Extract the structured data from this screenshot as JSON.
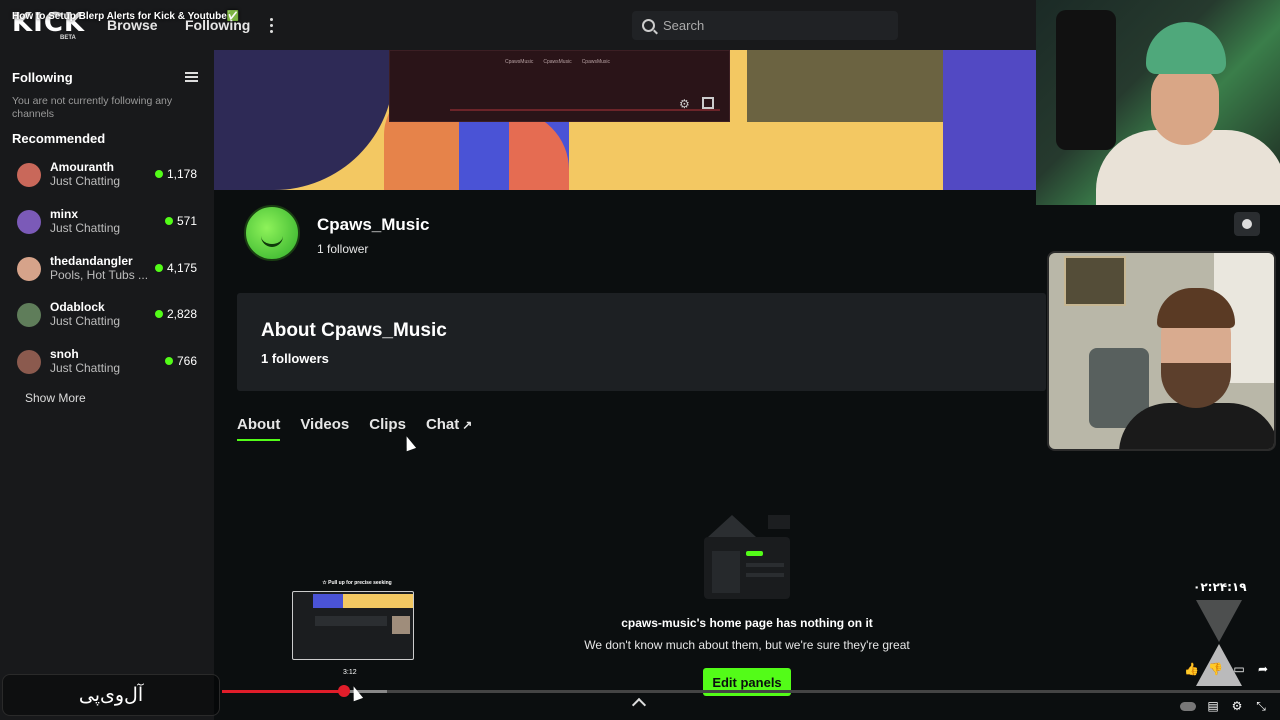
{
  "top_nav": {
    "logo": "KICK",
    "logo_badge": "BETA",
    "overlay_title": "How to Setup Blerp Alerts for Kick & Youtube✅",
    "browse_label": "Browse",
    "following_label": "Following",
    "search_placeholder": "Search"
  },
  "sidebar": {
    "following_heading": "Following",
    "following_empty": "You are not currently following any channels",
    "recommended_heading": "Recommended",
    "channels": [
      {
        "name": "Amouranth",
        "category": "Just Chatting",
        "viewers": "1,178",
        "avatar_color": "#c9685a"
      },
      {
        "name": "minx",
        "category": "Just Chatting",
        "viewers": "571",
        "avatar_color": "#7b5ab8"
      },
      {
        "name": "thedandangler",
        "category": "Pools, Hot Tubs ...",
        "viewers": "4,175",
        "avatar_color": "#d6a38a"
      },
      {
        "name": "Odablock",
        "category": "Just Chatting",
        "viewers": "2,828",
        "avatar_color": "#5f7d5a"
      },
      {
        "name": "snoh",
        "category": "Just Chatting",
        "viewers": "766",
        "avatar_color": "#8b5a4e"
      }
    ],
    "show_more": "Show More"
  },
  "banner": {
    "ghost_links": [
      "CpawsMusic",
      "CpawsMusic",
      "CpawsMusic"
    ]
  },
  "profile": {
    "name": "Cpaws_Music",
    "followers": "1 follower"
  },
  "about": {
    "title": "About Cpaws_Music",
    "followers": "1 followers"
  },
  "tabs": [
    {
      "label": "About",
      "active": true
    },
    {
      "label": "Videos",
      "active": false
    },
    {
      "label": "Clips",
      "active": false
    },
    {
      "label": "Chat",
      "active": false,
      "external": "↗"
    }
  ],
  "empty_state": {
    "title": "cpaws-music's home page has nothing on it",
    "subtitle": "We don't know much about them, but we're sure they're great",
    "button": "Edit panels"
  },
  "player": {
    "seek_hint": "☆ Pull up for precise seeking",
    "seek_time": "3:12",
    "progress": 0.115,
    "accent": "#e11d2a"
  },
  "overlay": {
    "watermark": "آل‌وی‌پی",
    "clock": "۰۲:۲۴:۱۹"
  },
  "colors": {
    "brand_green": "#53fc18",
    "bg": "#0b0e0f",
    "panel": "#18191b"
  }
}
